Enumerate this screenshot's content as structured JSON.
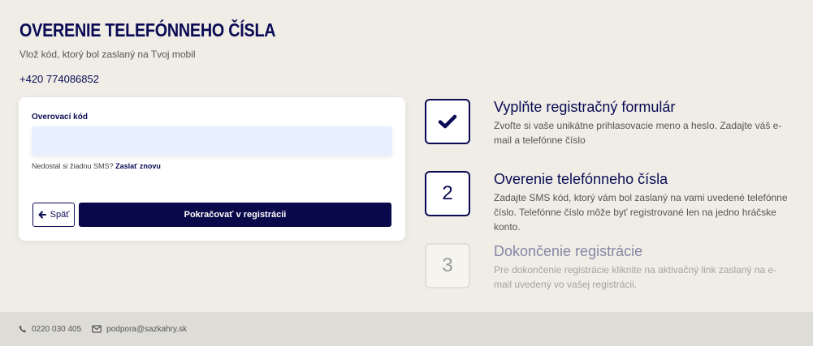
{
  "page": {
    "title": "OVERENIE TELEFÓNNEHO ČÍSLA",
    "subtitle": "Vlož kód, ktorý bol zaslaný na Tvoj mobil",
    "phone": "+420 774086852"
  },
  "form": {
    "code_label": "Overovací kód",
    "code_value": "",
    "no_sms_text": "Nedostal si žiadnu SMS?",
    "resend_link": "Zaslať znovu",
    "back_label": "Späť",
    "continue_label": "Pokračovať v registrácii"
  },
  "steps": [
    {
      "status": "done",
      "marker": "",
      "icon": "checkmark-icon",
      "title": "Vyplňte registračný formulár",
      "description": "Zvoľte si vaše unikátne prihlasovacie meno a heslo. Zadajte váš e-mail a telefónne číslo"
    },
    {
      "status": "active",
      "marker": "2",
      "title": "Overenie telefónneho čísla",
      "description": "Zadajte SMS kód, ktorý vám bol zaslaný na vami uvedené telefónne číslo. Telefónne číslo môže byť registrované len na jedno hráčske konto."
    },
    {
      "status": "pending",
      "marker": "3",
      "title": "Dokončenie registrácie",
      "description": "Pre dokončenie registrácie kliknite na aktivačný link zaslaný na e-mail uvedený vo vašej registrácii."
    }
  ],
  "footer": {
    "phone": "0220 030 405",
    "email": "podpora@sazkahry.sk"
  },
  "colors": {
    "background": "#efede6",
    "brand_navy": "#0b0b55",
    "button_navy": "#08084a",
    "input_bg": "#e8effd",
    "footer_bg": "#dddcd7"
  }
}
